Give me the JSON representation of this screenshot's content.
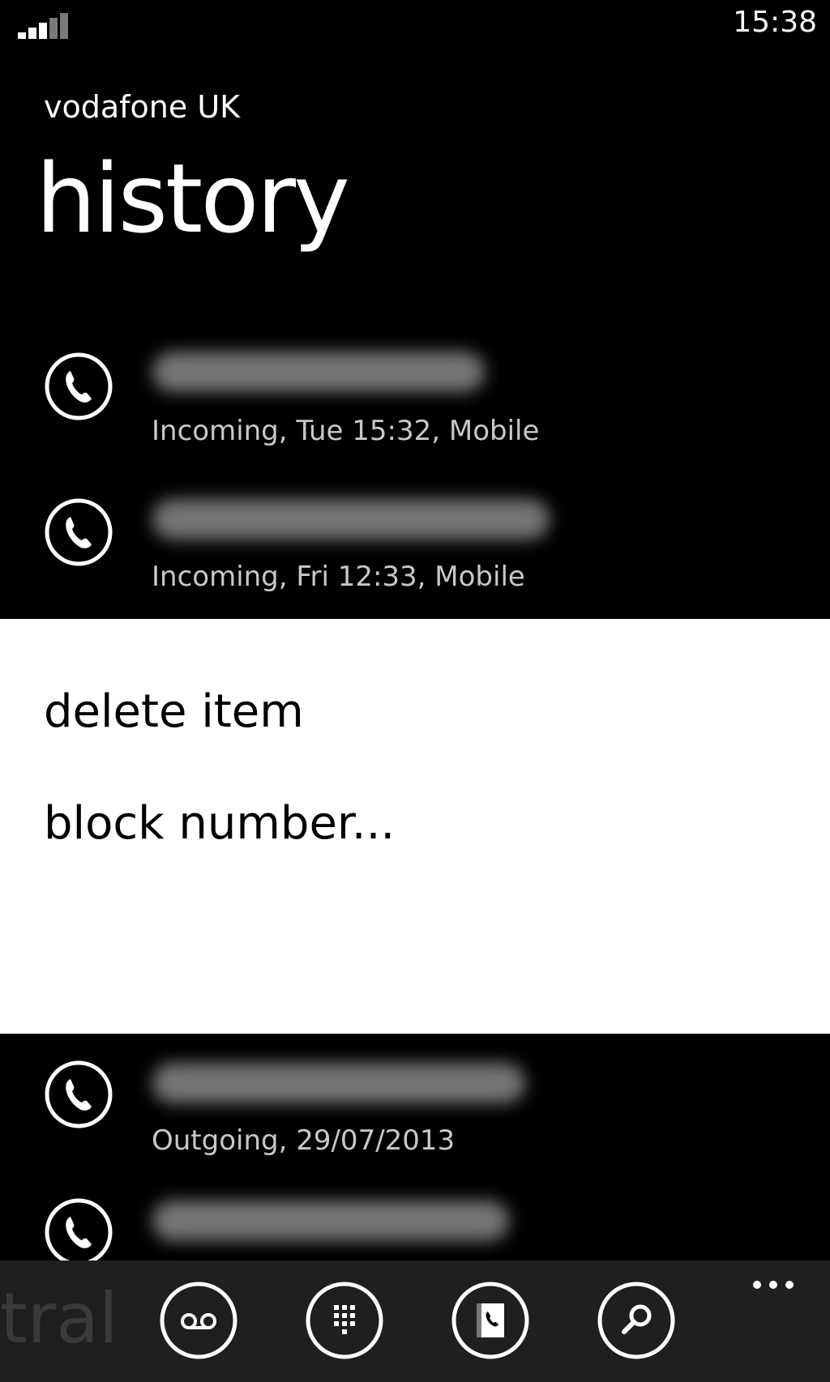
{
  "status_bar": {
    "time": "15:38",
    "signal_icon": "signal-strength-icon"
  },
  "header": {
    "carrier": "vodafone UK",
    "title": "history"
  },
  "calls": [
    {
      "detail": "Incoming, Tue 15:32, Mobile",
      "icon": "phone-icon"
    },
    {
      "detail": "Incoming, Fri 12:33, Mobile",
      "icon": "phone-icon"
    },
    {
      "detail": "Outgoing, 29/07/2013",
      "icon": "phone-icon"
    },
    {
      "detail": "",
      "icon": "phone-icon"
    }
  ],
  "context_menu": {
    "items": [
      "delete item",
      "block number..."
    ]
  },
  "app_bar": {
    "watermark": "tral",
    "buttons": [
      "voicemail-icon",
      "keypad-icon",
      "contacts-icon",
      "search-icon"
    ],
    "more_icon": "more-dots-icon"
  },
  "colors": {
    "background": "#000000",
    "menu_background": "#ffffff",
    "app_bar": "#1f1f1f",
    "detail_text": "#c8c8c8"
  }
}
